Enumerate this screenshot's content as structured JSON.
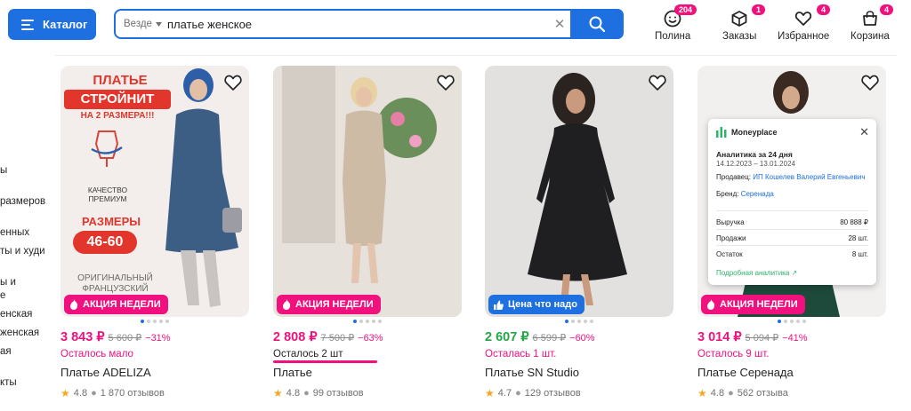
{
  "header": {
    "catalog_label": "Каталог",
    "search_scope": "Везде",
    "search_value": "платье женское",
    "nav": [
      {
        "label": "Полина",
        "badge": "204",
        "icon": "profile-icon"
      },
      {
        "label": "Заказы",
        "badge": "1",
        "icon": "box-icon"
      },
      {
        "label": "Избранное",
        "badge": "4",
        "icon": "heart-icon"
      },
      {
        "label": "Корзина",
        "badge": "4",
        "icon": "basket-icon"
      }
    ]
  },
  "sidebar": {
    "items": [
      "ы",
      "размеров",
      "енных",
      "ты и худи",
      "ы и",
      "е",
      "енская",
      "женская",
      "ая",
      "кты"
    ]
  },
  "colors": {
    "accent": "#1e6fe0",
    "promo": "#f1117e",
    "green": "#22a845"
  },
  "products": [
    {
      "price": "3 843 ₽",
      "old_price": "5 600 ₽",
      "discount": "−31%",
      "stock": "Осталось мало",
      "name": "Платье ADELIZA",
      "rating": "4.8",
      "reviews": "1 870 отзывов",
      "promo": "АКЦИЯ НЕДЕЛИ",
      "promo_color": "pink",
      "price_color": "pink",
      "image_text": {
        "title1": "ПЛАТЬЕ",
        "title2": "СТРОЙНИТ",
        "title3": "НА 2 РАЗМЕРА!!!",
        "quality1": "КАЧЕСТВО",
        "quality2": "ПРЕМИУМ",
        "sizes_label": "РАЗМЕРЫ",
        "sizes": "46-60",
        "orig1": "ОРИГИНАЛЬНЫЙ",
        "orig2": "ФРАНЦУЗСКИЙ"
      }
    },
    {
      "price": "2 808 ₽",
      "old_price": "7 500 ₽",
      "discount": "−63%",
      "stock": "Осталось 2 шт",
      "name": "Платье",
      "rating": "4.8",
      "reviews": "99 отзывов",
      "promo": "АКЦИЯ НЕДЕЛИ",
      "promo_color": "pink",
      "price_color": "pink"
    },
    {
      "price": "2 607 ₽",
      "old_price": "6 599 ₽",
      "discount": "−60%",
      "stock": "Осталась 1 шт.",
      "name": "Платье SN Studio",
      "rating": "4.7",
      "reviews": "129 отзывов",
      "promo": "Цена что надо",
      "promo_color": "blue",
      "price_color": "green"
    },
    {
      "price": "3 014 ₽",
      "old_price": "5 094 ₽",
      "discount": "−41%",
      "stock": "Осталось 9 шт.",
      "name": "Платье Серенада",
      "rating": "4.8",
      "reviews": "562 отзыва",
      "promo": "АКЦИЯ НЕДЕЛИ",
      "promo_color": "pink",
      "price_color": "pink"
    }
  ],
  "analytics_popup": {
    "brand": "Moneyplace",
    "title": "Аналитика за 24 дня",
    "period": "14.12.2023 – 13.01.2024",
    "seller_label": "Продавец:",
    "seller": "ИП Кошелев Валерий Евгеньевич",
    "brand_label": "Бренд:",
    "brand_value": "Серенада",
    "rows": [
      {
        "label": "Выручка",
        "value": "80 888 ₽"
      },
      {
        "label": "Продажи",
        "value": "28 шт."
      },
      {
        "label": "Остаток",
        "value": "8 шт."
      }
    ],
    "link": "Подробная аналитика"
  }
}
